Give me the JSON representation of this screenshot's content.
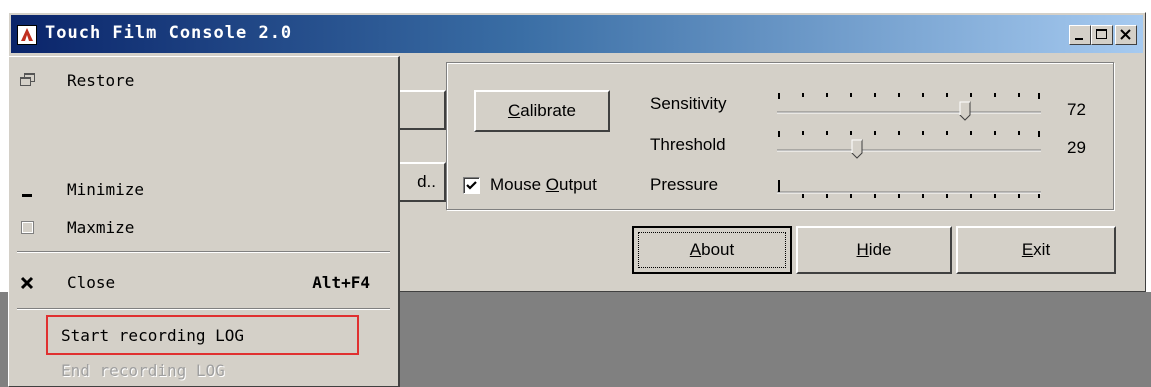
{
  "window": {
    "title": "Touch Film Console 2.0",
    "title_icon": "app-icon",
    "caption_buttons": [
      "minimize-icon",
      "maximize-icon",
      "close-icon"
    ]
  },
  "buttons": {
    "left_partial_label": "d..",
    "calibrate_label": "Calibrate",
    "about_label": "About",
    "hide_label": "Hide",
    "exit_label": "Exit"
  },
  "settings": {
    "mouse_output_label": "Mouse Output",
    "mouse_output_checked": true,
    "sliders": [
      {
        "label": "Sensitivity",
        "value": "72"
      },
      {
        "label": "Threshold",
        "value": "29"
      },
      {
        "label": "Pressure",
        "value": ""
      }
    ]
  },
  "system_menu": {
    "items": [
      {
        "label": "Restore",
        "icon": "restore-icon",
        "enabled": true
      },
      {
        "label": "Minimize",
        "icon": "minimize-icon",
        "enabled": true
      },
      {
        "label": "Maxmize",
        "icon": "maximize-icon",
        "enabled": true
      },
      {
        "label": "Close",
        "icon": "close-icon",
        "shortcut": "Alt+F4",
        "enabled": true
      },
      {
        "label": "Start recording LOG",
        "enabled": true,
        "highlighted": true
      },
      {
        "label": "End recording LOG",
        "enabled": false
      }
    ]
  },
  "colors": {
    "highlight_box": "#e03030",
    "titlebar_start": "#0a246a",
    "titlebar_end": "#a6caf0",
    "face": "#d4d0c8"
  }
}
